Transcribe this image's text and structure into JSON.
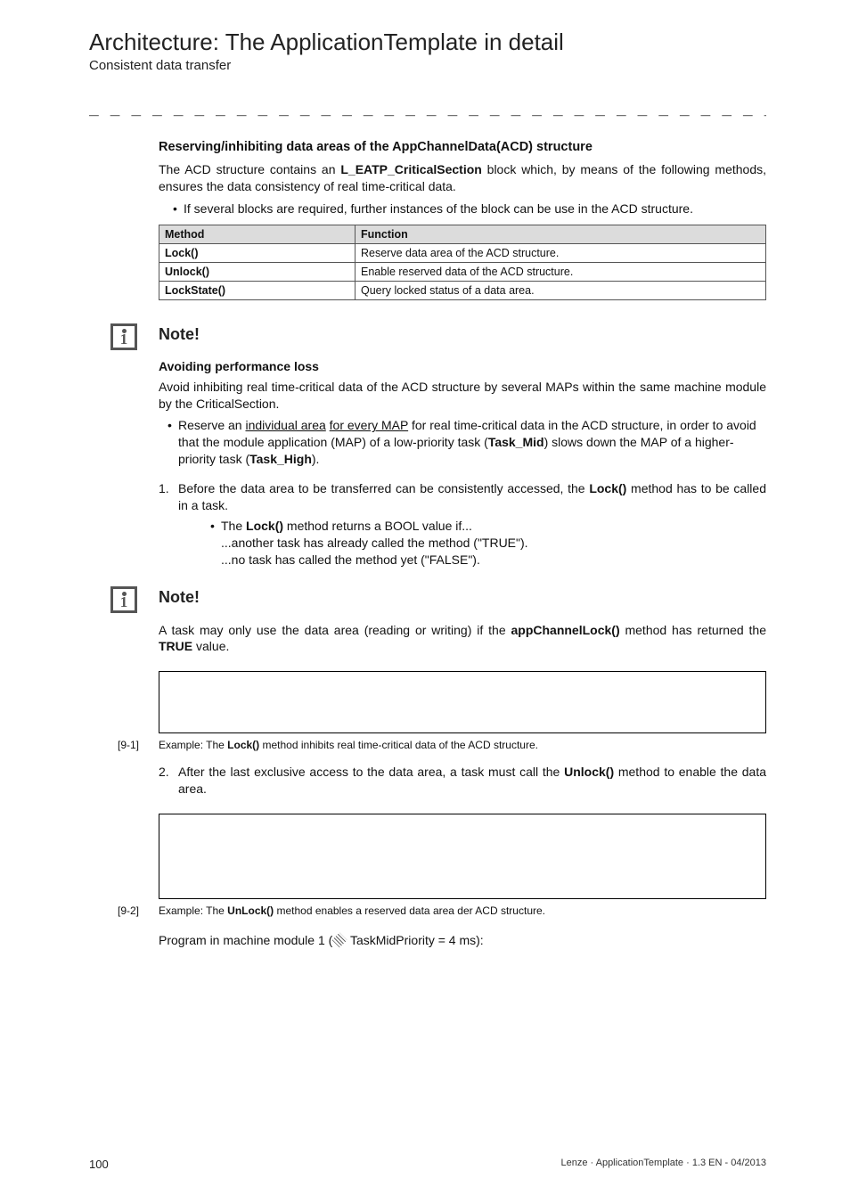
{
  "header": {
    "title": "Architecture: The ApplicationTemplate in detail",
    "subtitle": "Consistent data transfer"
  },
  "section": {
    "heading": "Reserving/inhibiting data areas of the AppChannelData(ACD) structure",
    "intro_pre": "The ACD structure contains an ",
    "intro_bold": "L_EATP_CriticalSection",
    "intro_post": " block which, by means of the following methods, ensures the data consistency of real time-critical data.",
    "intro_bullet": "If several blocks are required, further instances of the block can be use in the ACD structure."
  },
  "table": {
    "headers": [
      "Method",
      "Function"
    ],
    "rows": [
      [
        "Lock()",
        "Reserve data area of the ACD structure."
      ],
      [
        "Unlock()",
        "Enable reserved data of the ACD structure."
      ],
      [
        "LockState()",
        "Query locked status of a data area."
      ]
    ]
  },
  "note1": {
    "label": "Note!",
    "sub": "Avoiding performance loss",
    "body": "Avoid inhibiting real time-critical data of the ACD structure by several MAPs within the same machine module by the CriticalSection.",
    "bullet_pre": "Reserve an ",
    "bullet_u1": "individual area",
    "bullet_mid": " ",
    "bullet_u2": "for every MAP",
    "bullet_post1": " for real time-critical data in the ACD structure, in order to avoid that the module application (MAP) of a low-priority task (",
    "bullet_bold1": "Task_Mid",
    "bullet_post2": ") slows down the MAP of a higher-priority task (",
    "bullet_bold2": "Task_High",
    "bullet_post3": ")."
  },
  "step1": {
    "num": "1.",
    "pre": "Before the data area to be transferred can be consistently accessed, the ",
    "bold": "Lock()",
    "post": " method has to be called in a task.",
    "sub_pre": "The ",
    "sub_bold": "Lock()",
    "sub_post": " method returns a BOOL value if...",
    "line1": "...another task has already called the method (\"TRUE\").",
    "line2": "...no task has called the method yet (\"FALSE\")."
  },
  "note2": {
    "label": "Note!",
    "pre": "A task may only use the data area (reading or writing) if the ",
    "bold": "appChannelLock()",
    "mid": " method has returned the ",
    "bold2": "TRUE",
    "post": " value."
  },
  "fig1": {
    "ref": "[9-1]",
    "pre": "Example: The ",
    "bold": "Lock()",
    "post": " method inhibits real time-critical data of the ACD structure."
  },
  "step2": {
    "num": "2.",
    "pre": "After the last exclusive access to the data area, a task must call the ",
    "bold": "Unlock()",
    "post": " method to enable the data area."
  },
  "fig2": {
    "ref": "[9-2]",
    "pre": "Example: The ",
    "bold": "UnLock()",
    "post": " method enables a reserved data area der ACD structure."
  },
  "program": {
    "pre": "Program in machine module 1 (",
    "post": " TaskMidPriority = 4 ms):"
  },
  "footer": {
    "page": "100",
    "right": "Lenze · ApplicationTemplate · 1.3 EN - 04/2013"
  }
}
